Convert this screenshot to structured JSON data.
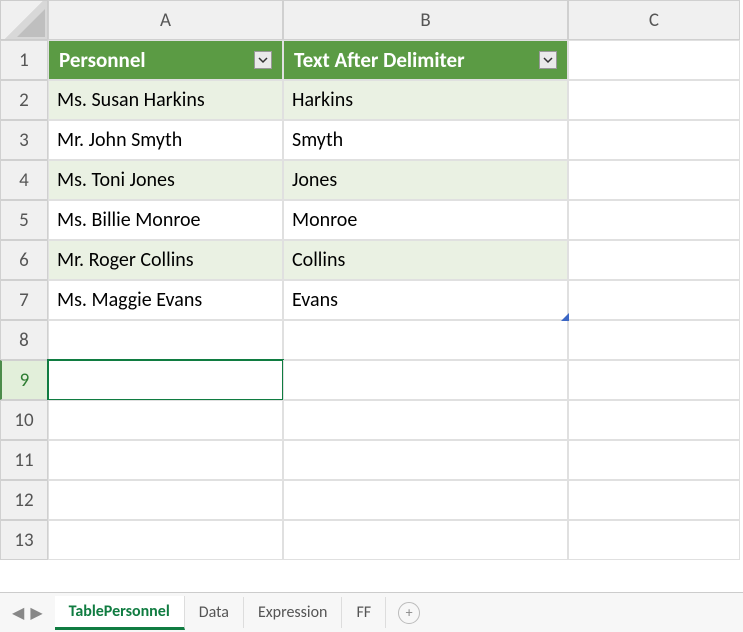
{
  "columns": [
    "A",
    "B",
    "C"
  ],
  "rows": [
    "1",
    "2",
    "3",
    "4",
    "5",
    "6",
    "7",
    "8",
    "9",
    "10",
    "11",
    "12",
    "13"
  ],
  "headers": {
    "personnel": "Personnel",
    "after": "Text After Delimiter"
  },
  "chart_data": {
    "type": "table",
    "columns": [
      "Personnel",
      "Text After Delimiter"
    ],
    "records": [
      {
        "Personnel": "Ms. Susan Harkins",
        "Text After Delimiter": "Harkins"
      },
      {
        "Personnel": "Mr. John Smyth",
        "Text After Delimiter": "Smyth"
      },
      {
        "Personnel": "Ms. Toni Jones",
        "Text After Delimiter": "Jones"
      },
      {
        "Personnel": "Ms. Billie Monroe",
        "Text After Delimiter": "Monroe"
      },
      {
        "Personnel": "Mr. Roger Collins",
        "Text After Delimiter": "Collins"
      },
      {
        "Personnel": "Ms. Maggie Evans",
        "Text After Delimiter": "Evans"
      }
    ]
  },
  "tabs": {
    "t1": "TablePersonnel",
    "t2": "Data",
    "t3": "Expression",
    "t4": "FF"
  }
}
